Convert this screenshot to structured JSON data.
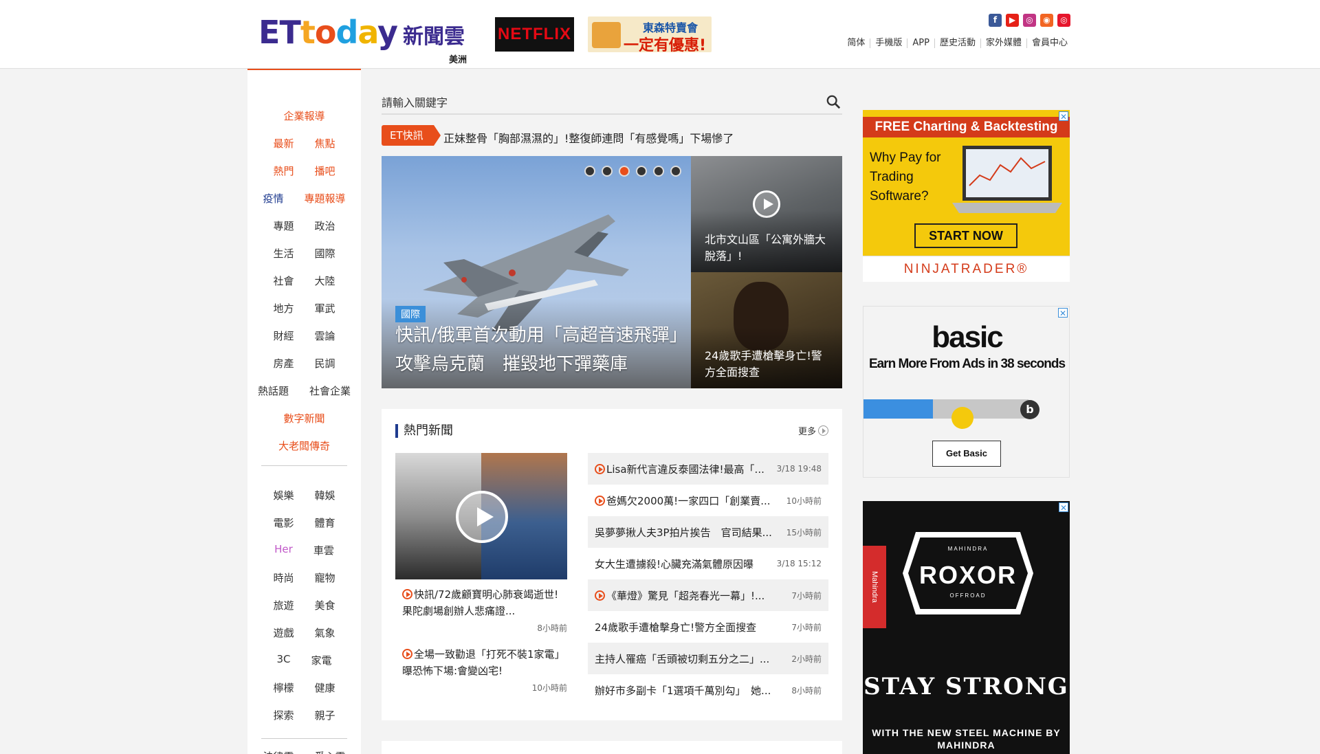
{
  "header": {
    "logo_letters": [
      "E",
      "T",
      "t",
      "o",
      "d",
      "a",
      "y"
    ],
    "logo_cn": "新聞雲",
    "region": "美洲",
    "netflix": "NETFLIX",
    "dongsen_line1": "東森特賣會",
    "dongsen_line2": "一定有優惠!",
    "social": [
      {
        "name": "facebook",
        "glyph": "f",
        "color": "#3b5998"
      },
      {
        "name": "youtube",
        "glyph": "▶",
        "color": "#e62117"
      },
      {
        "name": "instagram",
        "glyph": "◎",
        "color": "#c13584"
      },
      {
        "name": "rss",
        "glyph": "◉",
        "color": "#f26522"
      },
      {
        "name": "weibo",
        "glyph": "◎",
        "color": "#e6162d"
      }
    ],
    "nav": [
      "简体",
      "手機版",
      "APP",
      "歷史活動",
      "家外媒體",
      "會員中心"
    ]
  },
  "sidebar": {
    "rows": [
      {
        "items": [
          {
            "label": "企業報導",
            "style": "orange"
          }
        ]
      },
      {
        "items": [
          {
            "label": "最新",
            "style": "orange"
          },
          {
            "label": "焦點",
            "style": "orange"
          }
        ]
      },
      {
        "items": [
          {
            "label": "熱門",
            "style": "orange"
          },
          {
            "label": "播吧",
            "style": "orange"
          }
        ]
      },
      {
        "items": [
          {
            "label": "疫情",
            "style": "blue"
          },
          {
            "label": "專題報導",
            "style": "orange"
          }
        ]
      },
      {
        "items": [
          {
            "label": "專題",
            "style": ""
          },
          {
            "label": "政治",
            "style": ""
          }
        ]
      },
      {
        "items": [
          {
            "label": "生活",
            "style": ""
          },
          {
            "label": "國際",
            "style": ""
          }
        ]
      },
      {
        "items": [
          {
            "label": "社會",
            "style": ""
          },
          {
            "label": "大陸",
            "style": ""
          }
        ]
      },
      {
        "items": [
          {
            "label": "地方",
            "style": ""
          },
          {
            "label": "軍武",
            "style": ""
          }
        ]
      },
      {
        "items": [
          {
            "label": "財經",
            "style": ""
          },
          {
            "label": "雲論",
            "style": ""
          }
        ]
      },
      {
        "items": [
          {
            "label": "房產",
            "style": ""
          },
          {
            "label": "民調",
            "style": ""
          }
        ]
      },
      {
        "items": [
          {
            "label": "熱話題",
            "style": ""
          },
          {
            "label": "社會企業",
            "style": ""
          }
        ]
      },
      {
        "items": [
          {
            "label": "數字新聞",
            "style": "orange"
          }
        ]
      },
      {
        "items": [
          {
            "label": "大老闆傳奇",
            "style": "orange"
          }
        ]
      }
    ],
    "rows2": [
      {
        "items": [
          {
            "label": "娛樂",
            "style": ""
          },
          {
            "label": "韓娛",
            "style": ""
          }
        ]
      },
      {
        "items": [
          {
            "label": "電影",
            "style": ""
          },
          {
            "label": "體育",
            "style": ""
          }
        ]
      },
      {
        "items": [
          {
            "label": "Her",
            "style": "pink"
          },
          {
            "label": "車雲",
            "style": ""
          }
        ]
      },
      {
        "items": [
          {
            "label": "時尚",
            "style": ""
          },
          {
            "label": "寵物",
            "style": ""
          }
        ]
      },
      {
        "items": [
          {
            "label": "旅遊",
            "style": ""
          },
          {
            "label": "美食",
            "style": ""
          }
        ]
      },
      {
        "items": [
          {
            "label": "遊戲",
            "style": ""
          },
          {
            "label": "氣象",
            "style": ""
          }
        ]
      },
      {
        "items": [
          {
            "label": "3C",
            "style": ""
          },
          {
            "label": "家電",
            "style": ""
          }
        ]
      },
      {
        "items": [
          {
            "label": "檸檬",
            "style": ""
          },
          {
            "label": "健康",
            "style": ""
          }
        ]
      },
      {
        "items": [
          {
            "label": "探索",
            "style": ""
          },
          {
            "label": "親子",
            "style": ""
          }
        ]
      }
    ],
    "rows3": [
      {
        "items": [
          {
            "label": "法律雲",
            "style": ""
          },
          {
            "label": "愛心雲",
            "style": ""
          }
        ]
      }
    ]
  },
  "search": {
    "placeholder": "請輸入關鍵字"
  },
  "flash": {
    "tag": "ET快訊",
    "text": "正妹整骨「胸部濕濕的」!整復師連問「有感覺嗎」下場慘了"
  },
  "hero": {
    "category": "國際",
    "title": "快訊/俄軍首次動用「高超音速飛彈」攻擊烏克蘭　摧毀地下彈藥庫",
    "slides": 6,
    "active_slide": 2,
    "side": [
      {
        "title": "北市文山區「公寓外牆大脫落」!"
      },
      {
        "title": "24歲歌手遭槍擊身亡!警方全面搜查"
      }
    ]
  },
  "hot": {
    "heading": "熱門新聞",
    "more": "更多",
    "left": [
      {
        "title": "快訊/72歲顧寶明心肺衰竭逝世!果陀劇場創辦人悲痛證...",
        "time": "8小時前"
      },
      {
        "title": "全場一致勸退「打死不裝1家電」　曝恐怖下場:會變凶宅!",
        "time": "10小時前"
      }
    ],
    "list": [
      {
        "title": "Lisa新代言違反泰國法律!最高「...",
        "time": "3/18 19:48",
        "video": true
      },
      {
        "title": "爸媽欠2000萬!一家四口「創業賣...",
        "time": "10小時前",
        "video": true
      },
      {
        "title": "吳夢夢揪人夫3P拍片挨告　官司結果...",
        "time": "15小時前",
        "video": false
      },
      {
        "title": "女大生遭擄殺!心臟充滿氣體原因曝",
        "time": "3/18 15:12",
        "video": false
      },
      {
        "title": "《華燈》驚見「超尧春光一幕」!...",
        "time": "7小時前",
        "video": true
      },
      {
        "title": "24歲歌手遭槍擊身亡!警方全面搜查",
        "time": "7小時前",
        "video": false
      },
      {
        "title": "主持人罹癌「舌頭被切剩五分之二」...",
        "time": "2小時前",
        "video": false
      },
      {
        "title": "辦好市多副卡「1選項千萬別勾」　她...",
        "time": "8小時前",
        "video": false
      }
    ]
  },
  "ads": {
    "ad1": {
      "bar": "FREE Charting & Backtesting",
      "question": "Why Pay for Trading Software?",
      "cta": "START NOW",
      "brand": "NINJATRADER®"
    },
    "ad2": {
      "logo": "basic",
      "headline": "Earn More From Ads in 38 seconds",
      "cta": "Get Basic",
      "progress": 0.42,
      "end_glyph": "b"
    },
    "ad3": {
      "side": "Mahindra",
      "top": "MAHINDRA",
      "brand": "ROXOR",
      "sub": "OFFROAD",
      "headline": "STAY STRONG",
      "tagline": "WITH THE NEW STEEL MACHINE BY MAHINDRA"
    }
  },
  "colors": {
    "accent": "#e84e1b",
    "navy": "#1f3b8f"
  }
}
